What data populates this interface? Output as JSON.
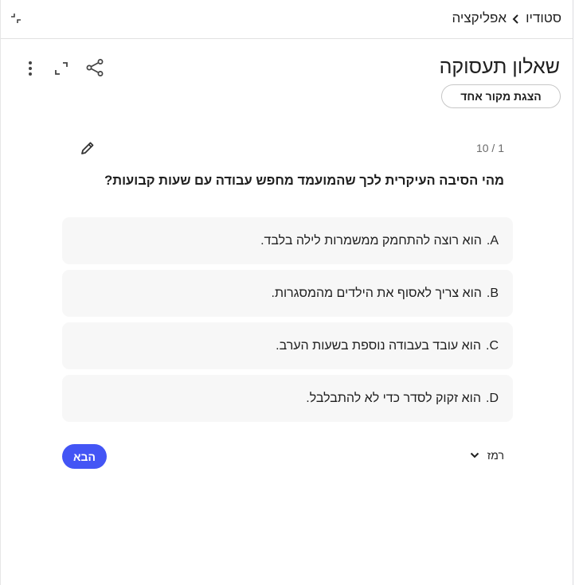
{
  "breadcrumb": {
    "root": "סטודיו",
    "current": "אפליקציה"
  },
  "header": {
    "title": "שאלון תעסוקה",
    "source_button": "הצגת מקור אחד"
  },
  "quiz": {
    "counter": "10 / 1",
    "question": "מהי הסיבה העיקרית לכך שהמועמד מחפש עבודה עם שעות קבועות?",
    "options": [
      {
        "letter": "A.",
        "text": "הוא רוצה להתחמק ממשמרות לילה בלבד."
      },
      {
        "letter": "B.",
        "text": "הוא צריך לאסוף את הילדים מהמסגרות."
      },
      {
        "letter": "C.",
        "text": "הוא עובד בעבודה נוספת בשעות הערב."
      },
      {
        "letter": "D.",
        "text": "הוא זקוק לסדר כדי לא להתבלבל."
      }
    ],
    "hint_label": "רמז",
    "next_label": "הבא"
  },
  "icons": {
    "collapse": "collapse-icon",
    "breadcrumb_separator": "chevron-right-icon",
    "more": "more-vert-icon",
    "expand": "expand-icon",
    "share": "share-icon",
    "edit": "pencil-icon",
    "hint_toggle": "chevron-down-icon"
  },
  "colors": {
    "accent": "#4355f5",
    "option_background": "#f7f7f7",
    "text": "#1f1f1f",
    "muted": "#6b6b6b"
  }
}
